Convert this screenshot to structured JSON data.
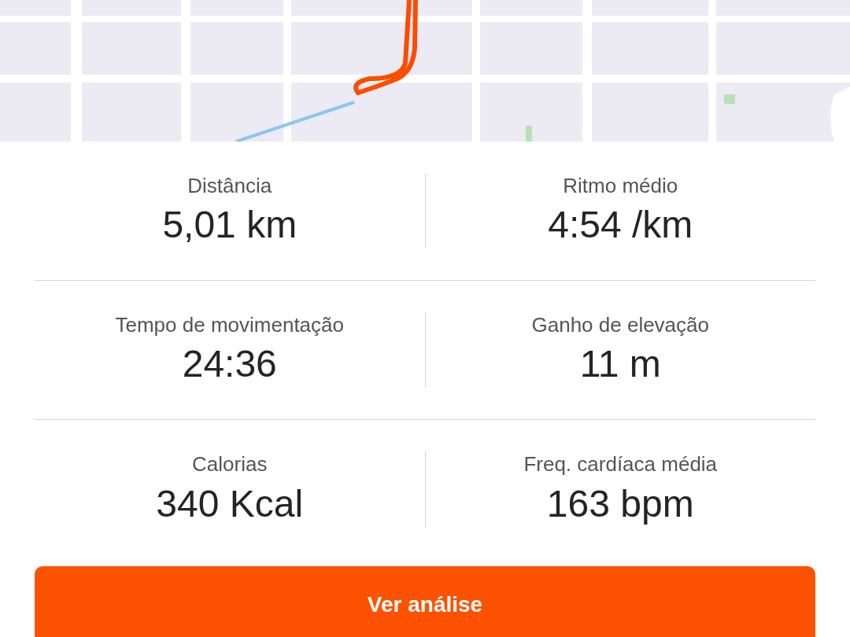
{
  "stats": [
    {
      "label": "Distância",
      "value": "5,01 km"
    },
    {
      "label": "Ritmo médio",
      "value": "4:54 /km"
    },
    {
      "label": "Tempo de movimentação",
      "value": "24:36"
    },
    {
      "label": "Ganho de elevação",
      "value": "11 m"
    },
    {
      "label": "Calorias",
      "value": "340 Kcal"
    },
    {
      "label": "Freq. cardíaca média",
      "value": "163 bpm"
    }
  ],
  "button": {
    "label": "Ver análise"
  }
}
